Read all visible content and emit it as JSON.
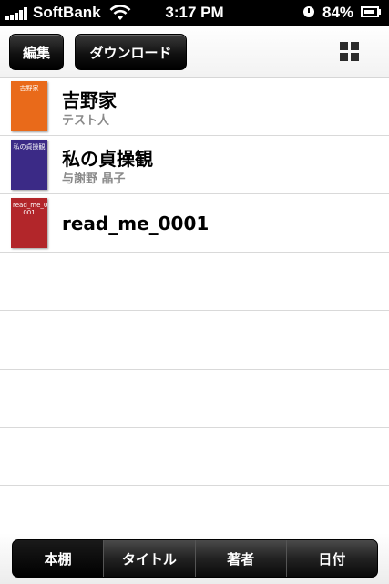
{
  "status_bar": {
    "carrier": "SoftBank",
    "time": "3:17 PM",
    "battery": "84%",
    "battery_level": 0.84
  },
  "toolbar": {
    "edit_label": "編集",
    "download_label": "ダウンロード",
    "view_icon": "grid-icon"
  },
  "books": [
    {
      "title": "吉野家",
      "author": "テスト人",
      "cover_color": "#e96a1a",
      "cover_text": "吉野家"
    },
    {
      "title": "私の貞操観",
      "author": "与謝野 晶子",
      "cover_color": "#3b2a86",
      "cover_text": "私の貞操観"
    },
    {
      "title": "read_me_0001",
      "author": "",
      "cover_color": "#b2262a",
      "cover_text": "read_me_0 001"
    }
  ],
  "tabs": [
    {
      "label": "本棚",
      "active": true
    },
    {
      "label": "タイトル",
      "active": false
    },
    {
      "label": "著者",
      "active": false
    },
    {
      "label": "日付",
      "active": false
    }
  ]
}
